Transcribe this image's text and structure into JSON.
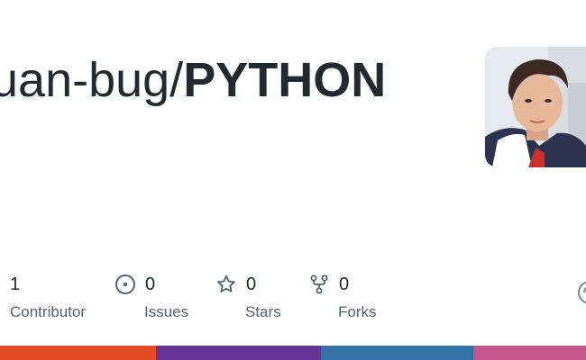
{
  "repo": {
    "owner_fragment": "uan-bug/",
    "name": "PYTHON"
  },
  "avatar": {
    "alt_semantic": "owner-avatar-photo"
  },
  "stats": [
    {
      "key": "contributors",
      "value": "1",
      "label": "Contributor",
      "icon": "people-icon"
    },
    {
      "key": "issues",
      "value": "0",
      "label": "Issues",
      "icon": "issue-opened-icon"
    },
    {
      "key": "stars",
      "value": "0",
      "label": "Stars",
      "icon": "star-icon"
    },
    {
      "key": "forks",
      "value": "0",
      "label": "Forks",
      "icon": "repo-forked-icon"
    }
  ],
  "language_bar": [
    {
      "color": "#e34c26",
      "share": 0.266
    },
    {
      "color": "#663399",
      "share": 0.282
    },
    {
      "color": "#3572A5",
      "share": 0.26
    },
    {
      "color": "#c6538c",
      "share": 0.192
    }
  ],
  "colors": {
    "text": "#24292f",
    "muted": "#57606a"
  }
}
